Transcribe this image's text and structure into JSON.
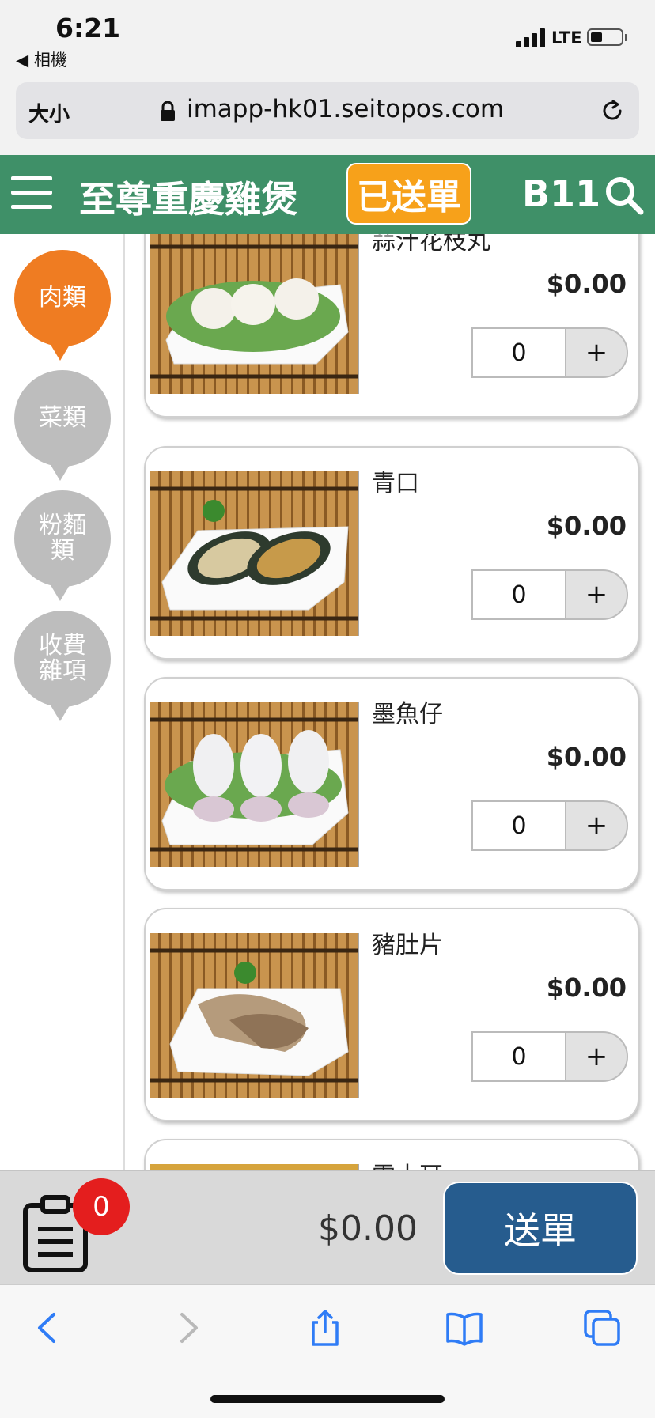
{
  "status_bar": {
    "time": "6:21",
    "back_app": "◀ 相機",
    "network": "LTE"
  },
  "browser": {
    "text_size_label": "大小",
    "url": "imapp-hk01.seitopos.com"
  },
  "header": {
    "store_name": "至尊重慶雞煲",
    "sent_label": "已送單",
    "table_number": "B11"
  },
  "categories": [
    {
      "label": "肉類",
      "active": true
    },
    {
      "label": "菜類",
      "active": false
    },
    {
      "label": "粉麵\n類",
      "active": false
    },
    {
      "label": "收費\n雜項",
      "active": false
    }
  ],
  "items": [
    {
      "name": "蒜汁花枝丸",
      "price": "$0.00",
      "qty": "0",
      "plus": "+"
    },
    {
      "name": "青口",
      "price": "$0.00",
      "qty": "0",
      "plus": "+"
    },
    {
      "name": "墨魚仔",
      "price": "$0.00",
      "qty": "0",
      "plus": "+"
    },
    {
      "name": "豬肚片",
      "price": "$0.00",
      "qty": "0",
      "plus": "+"
    },
    {
      "name": "雲木耳",
      "price": "",
      "qty": "",
      "plus": ""
    }
  ],
  "order_bar": {
    "count": "0",
    "total": "$0.00",
    "submit_label": "送單"
  },
  "colors": {
    "header": "#3f9068",
    "accent_orange": "#ef7c22",
    "sent_button": "#f7a11a",
    "submit": "#265c8e",
    "badge": "#e41e1e"
  }
}
